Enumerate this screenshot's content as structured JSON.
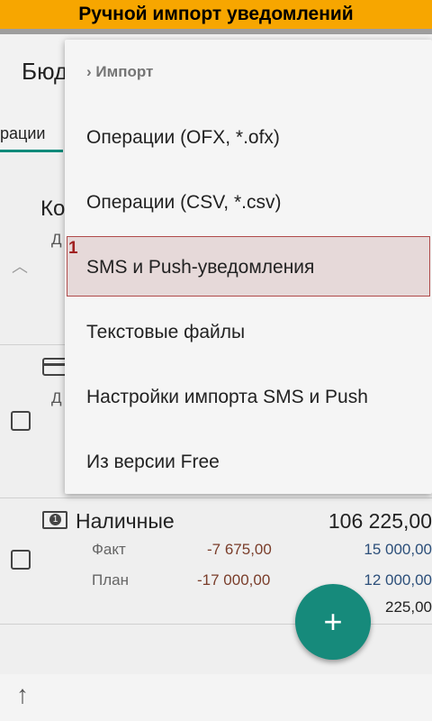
{
  "banner": {
    "text": "Ручной импорт уведомлений"
  },
  "appbar": {
    "title": "Бюд"
  },
  "tabs": {
    "active_label": "рации"
  },
  "section": {
    "title": "Ко",
    "subtitle": "Д"
  },
  "card_row": {
    "label": "Д"
  },
  "account": {
    "name": "Наличные",
    "total": "106 225,00",
    "fact_label": "Факт",
    "fact_value": "-7 675,00",
    "fact_right": "15 000,00",
    "plan_label": "План",
    "plan_value": "-17 000,00",
    "plan_right": "12 000,00",
    "extra_right": "225,00"
  },
  "menu": {
    "header": "Импорт",
    "items": [
      "Операции (OFX, *.ofx)",
      "Операции (CSV, *.csv)",
      "SMS и Push-уведомления",
      "Текстовые файлы",
      "Настройки импорта SMS и Push",
      "Из версии Free"
    ],
    "highlight_number": "1"
  },
  "icons": {
    "menu_header_chevron": "chevron-right-icon",
    "collapse": "chevron-up-icon",
    "card": "credit-card-icon",
    "cash": "cash-icon",
    "fab": "plus-icon",
    "bottom": "arrow-up-icon"
  },
  "colors": {
    "banner": "#f7a600",
    "accent": "#168a7b",
    "highlight_border": "#b04a4a"
  }
}
